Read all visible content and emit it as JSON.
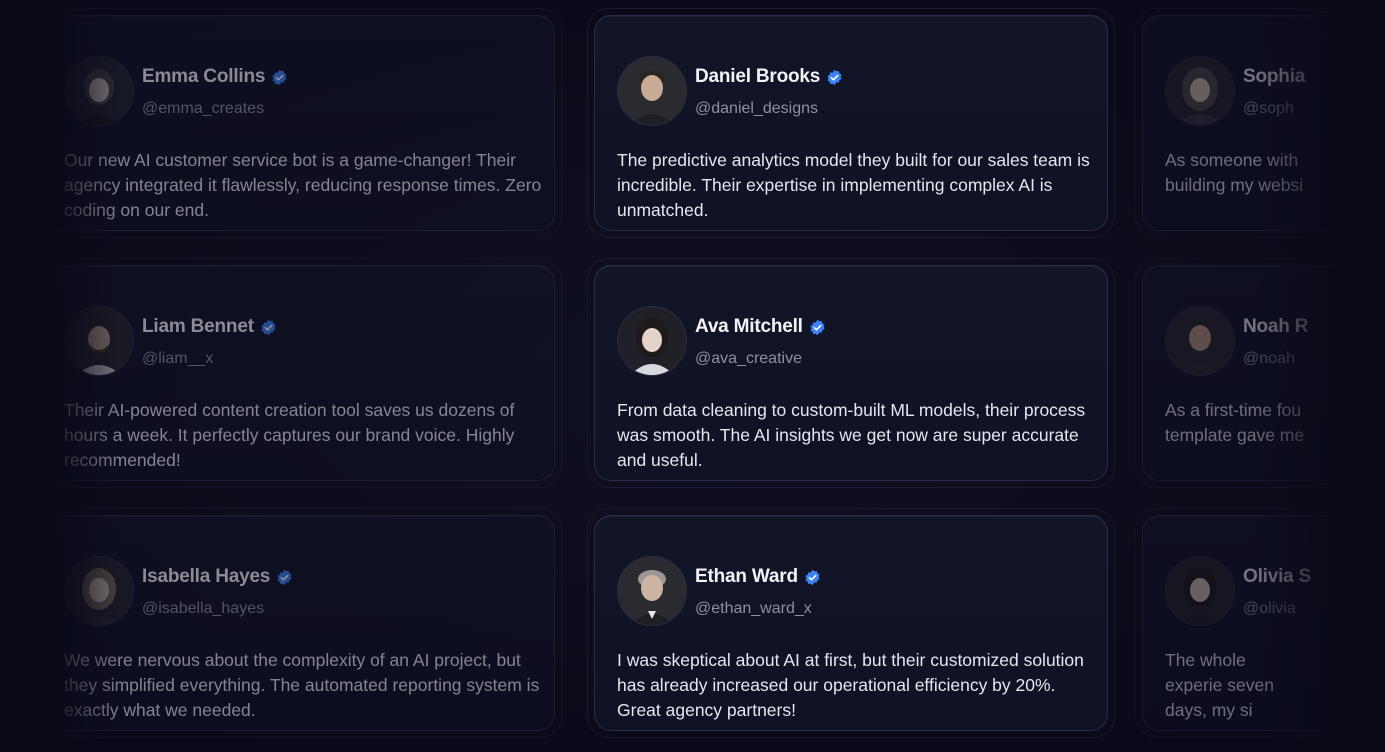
{
  "testimonials": {
    "left": [
      {
        "name": "Emma Collins",
        "handle": "@emma_creates",
        "avatar_icon": "woman-portrait-icon",
        "quote": "Our new AI customer service bot is a game-changer! Their agency integrated it flawlessly, reducing response times. Zero coding on our end."
      },
      {
        "name": "Liam Bennet",
        "handle": "@liam__x",
        "avatar_icon": "man-portrait-icon",
        "quote": "Their AI-powered content creation tool saves us dozens of hours a week. It perfectly captures our brand voice. Highly recommended!"
      },
      {
        "name": "Isabella Hayes",
        "handle": "@isabella_hayes",
        "avatar_icon": "woman-portrait-icon",
        "quote": "We were nervous about the complexity of an AI project, but they simplified everything. The automated reporting system is exactly what we needed."
      }
    ],
    "center": [
      {
        "name": "Daniel Brooks",
        "handle": "@daniel_designs",
        "avatar_icon": "man-portrait-icon",
        "quote": "The predictive analytics model they built for our sales team is incredible. Their expertise in implementing complex AI is unmatched."
      },
      {
        "name": "Ava Mitchell",
        "handle": "@ava_creative",
        "avatar_icon": "woman-portrait-icon",
        "quote": "From data cleaning to custom-built ML models, their process was smooth. The AI insights we get now are super accurate and useful."
      },
      {
        "name": "Ethan Ward",
        "handle": "@ethan_ward_x",
        "avatar_icon": "man-portrait-icon",
        "quote": "I was skeptical about AI at first, but their customized solution has already increased our operational efficiency by 20%. Great agency partners!"
      }
    ],
    "right": [
      {
        "name": "Sophia",
        "handle": "@soph",
        "avatar_icon": "woman-portrait-icon",
        "quote": "As someone with building my websi"
      },
      {
        "name": "Noah R",
        "handle": "@noah",
        "avatar_icon": "man-portrait-icon",
        "quote": "As a first-time fou template gave me"
      },
      {
        "name": "Olivia S",
        "handle": "@olivia",
        "avatar_icon": "woman-portrait-icon",
        "quote": "The whole experie seven days, my si"
      }
    ]
  },
  "colors": {
    "background": "#0b0b1a",
    "card": "#111327",
    "card_border": "#2a2d47",
    "verified_badge": "#3b82f6",
    "name_text": "#f2f3f7",
    "handle_text": "#8d90a3"
  }
}
